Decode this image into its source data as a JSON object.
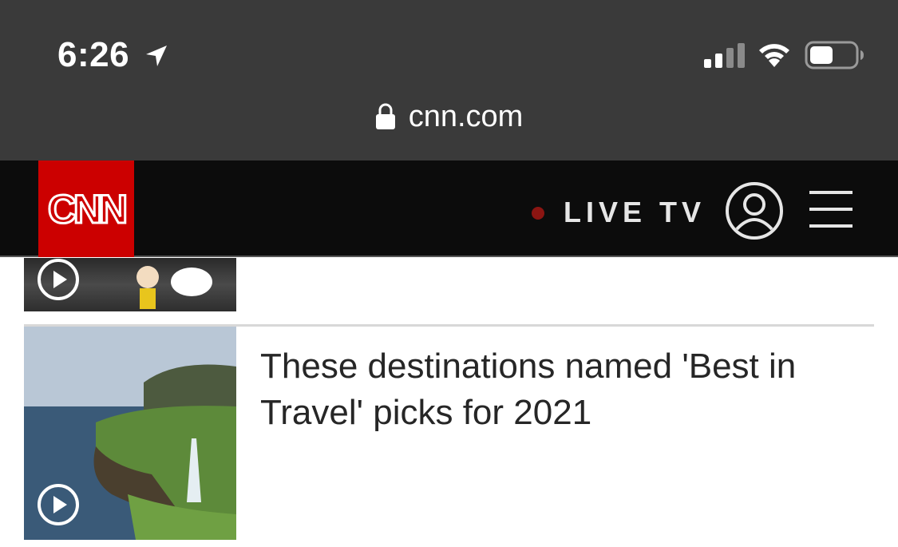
{
  "status_bar": {
    "time": "6:26",
    "icons": [
      "location-arrow-icon",
      "cell-signal-icon",
      "wifi-icon",
      "battery-icon"
    ]
  },
  "browser": {
    "url": "cnn.com",
    "lock_icon": "lock-icon"
  },
  "header": {
    "logo_text": "CNN",
    "live_tv_label": "LIVE TV",
    "account_icon": "user-circle-icon",
    "menu_icon": "hamburger-menu-icon",
    "colors": {
      "brand_red": "#cc0000",
      "header_bg": "#0c0c0c",
      "live_dot": "#8b1512"
    }
  },
  "stories": [
    {
      "has_video": true,
      "headline": ""
    },
    {
      "has_video": true,
      "headline": "These destinations named 'Best in Travel' picks for 2021"
    }
  ]
}
